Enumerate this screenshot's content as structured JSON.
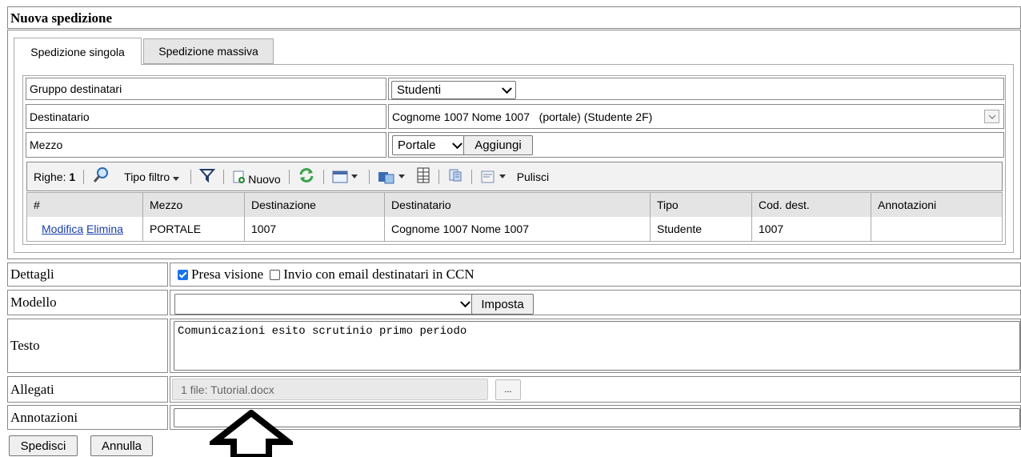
{
  "page": {
    "title": "Nuova spedizione"
  },
  "tabs": [
    {
      "label": "Spedizione singola",
      "active": true
    },
    {
      "label": "Spedizione massiva",
      "active": false
    }
  ],
  "form_top": {
    "gruppo_label": "Gruppo destinatari",
    "gruppo_value": "Studenti",
    "destinatario_label": "Destinatario",
    "destinatario_value": "Cognome 1007 Nome 1007   (portale) (Studente 2F)",
    "mezzo_label": "Mezzo",
    "mezzo_value": "Portale",
    "aggiungi_label": "Aggiungi"
  },
  "toolbar": {
    "rows_label": "Righe:",
    "rows_count": "1",
    "filter_type_label": "Tipo filtro",
    "new_label": "Nuovo",
    "clear_label": "Pulisci"
  },
  "grid": {
    "columns": [
      "#",
      "Mezzo",
      "Destinazione",
      "Destinatario",
      "Tipo",
      "Cod. dest.",
      "Annotazioni"
    ],
    "rows": [
      {
        "edit": "Modifica",
        "delete": "Elimina",
        "mezzo": "PORTALE",
        "destinazione": "1007",
        "destinatario": "Cognome 1007 Nome 1007",
        "tipo": "Studente",
        "cod_dest": "1007",
        "annotazioni": ""
      }
    ]
  },
  "details": {
    "dettagli_label": "Dettagli",
    "presa_visione_label": "Presa visione",
    "presa_visione_checked": true,
    "ccn_label": "Invio con email destinatari in CCN",
    "ccn_checked": false,
    "modello_label": "Modello",
    "modello_value": "",
    "imposta_label": "Imposta",
    "testo_label": "Testo",
    "testo_value": "Comunicazioni esito scrutinio primo periodo",
    "allegati_label": "Allegati",
    "allegati_value": "1 file: Tutorial.docx",
    "browse_label": "...",
    "annotazioni_label": "Annotazioni",
    "annotazioni_value": ""
  },
  "actions": {
    "send_label": "Spedisci",
    "cancel_label": "Annulla"
  },
  "colors": {
    "checkbox_accent": "#1a73e8",
    "link": "#1a3ea8",
    "toolbar_bg": "#f2f2f2",
    "grid_header_bg": "#e4e4e4"
  }
}
